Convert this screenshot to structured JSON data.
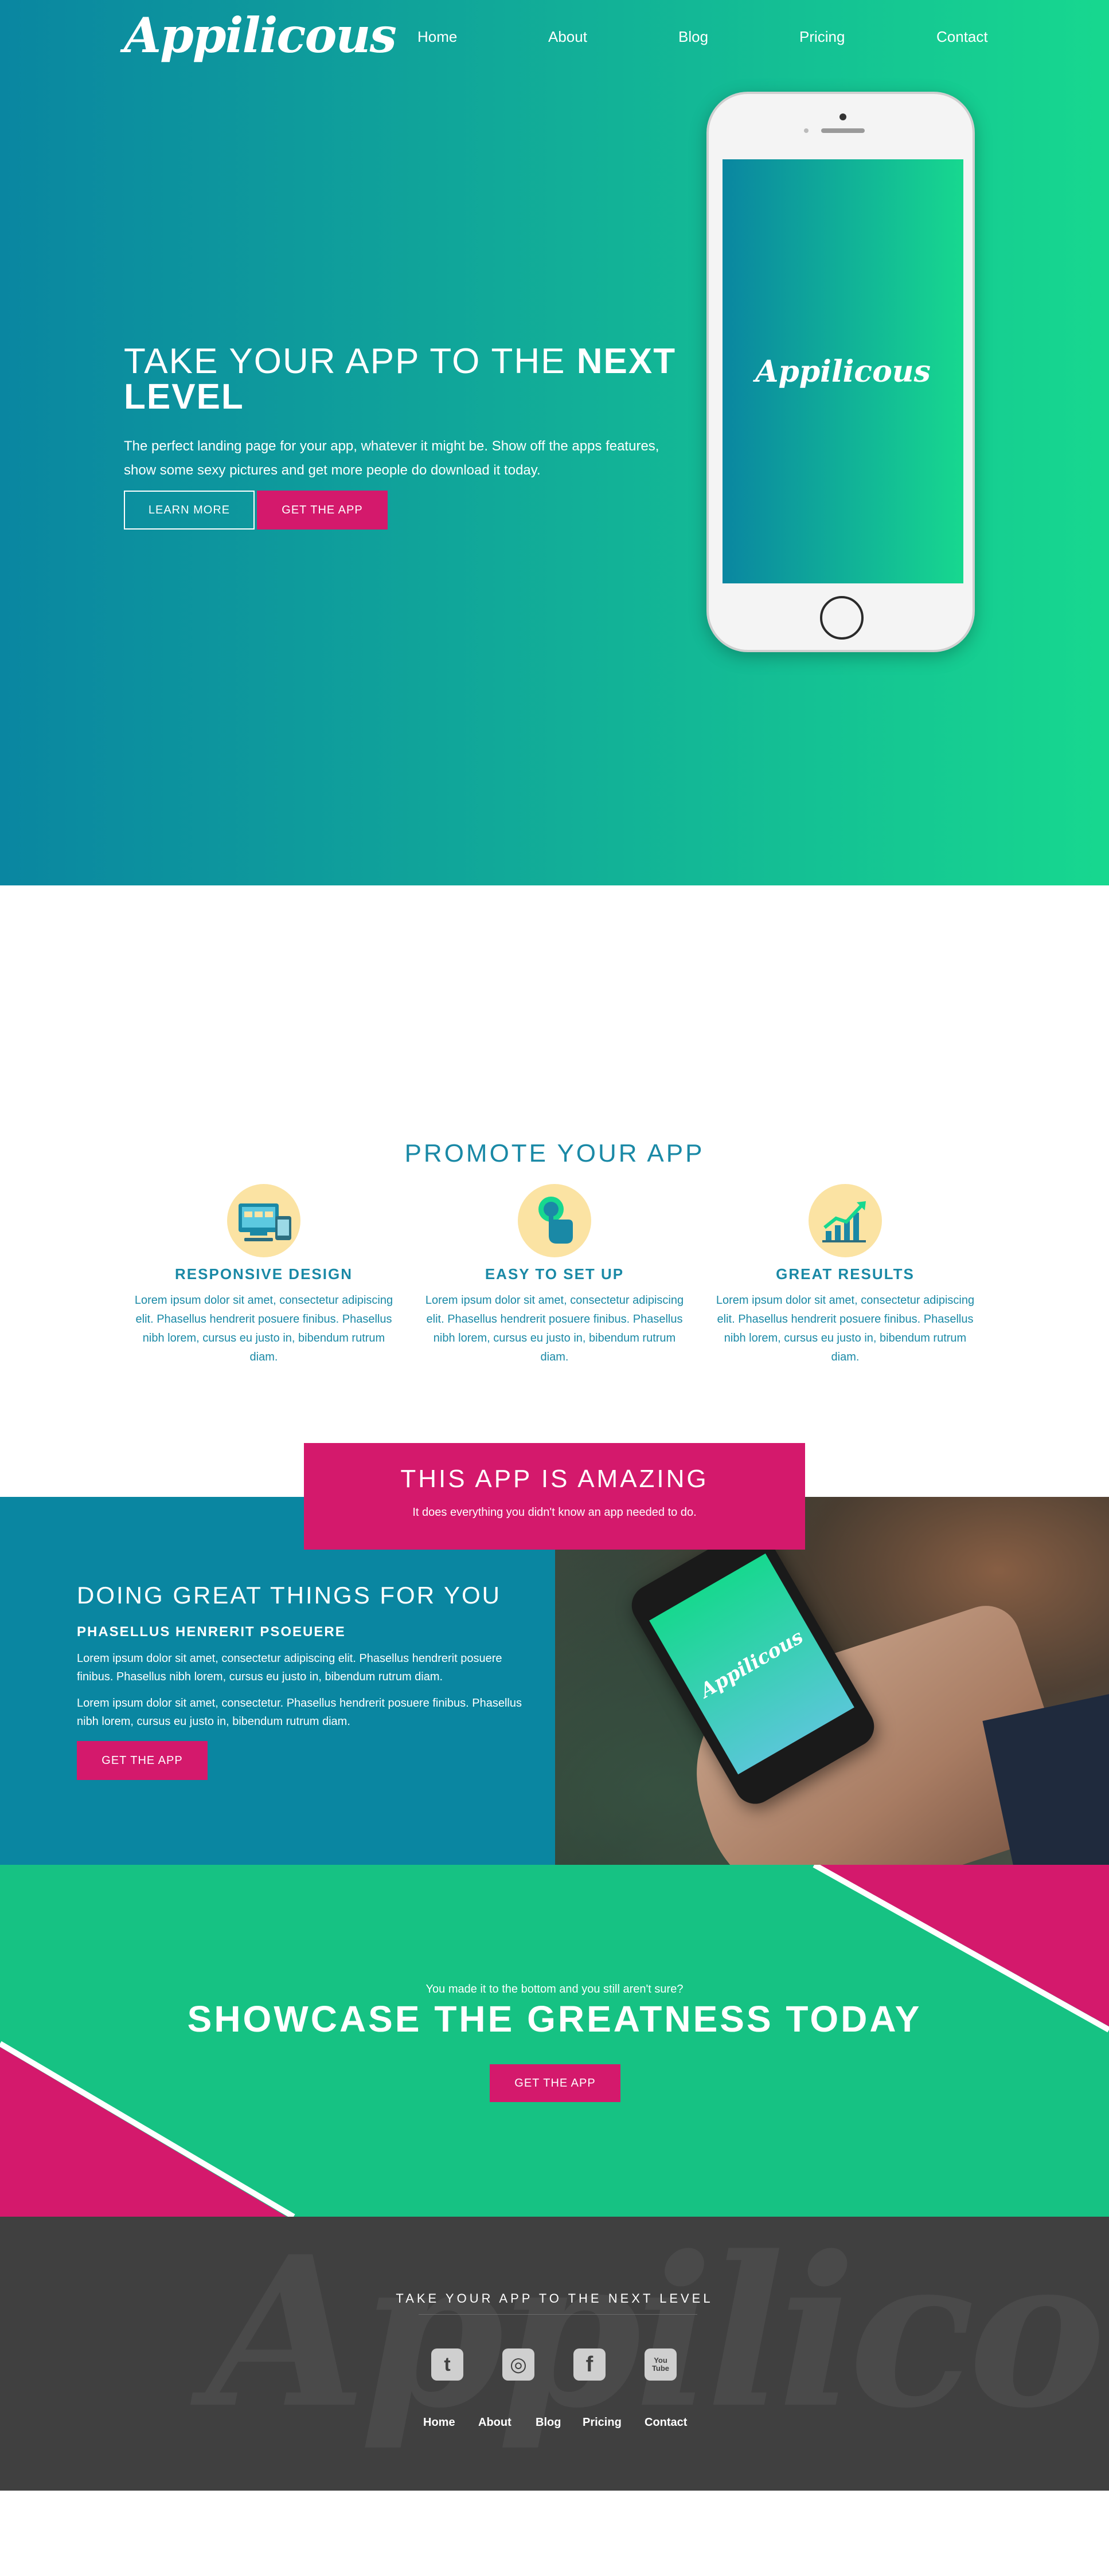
{
  "brand": {
    "logo": "Appilicous"
  },
  "nav": [
    "Home",
    "About",
    "Blog",
    "Pricing",
    "Contact"
  ],
  "hero": {
    "title_light": "TAKE YOUR APP TO THE ",
    "title_bold": "NEXT LEVEL",
    "subtitle": "The perfect landing page for your app, whatever it might be. Show off the apps features, show some sexy pictures and get more people do download it today.",
    "learn_more": "LEARN MORE",
    "get_app": "GET THE APP",
    "phone_logo": "Appilicous"
  },
  "promote": {
    "title": "PROMOTE YOUR APP",
    "features": [
      {
        "icon": "responsive-design-icon",
        "title": "RESPONSIVE DESIGN",
        "text": "Lorem ipsum dolor sit amet, consectetur adipiscing elit. Phasellus hendrerit posuere finibus. Phasellus nibh lorem, cursus eu justo in, bibendum rutrum diam."
      },
      {
        "icon": "tap-hand-icon",
        "title": "EASY TO SET UP",
        "text": "Lorem ipsum dolor sit amet, consectetur adipiscing elit. Phasellus hendrerit posuere finibus. Phasellus nibh lorem, cursus eu justo in, bibendum rutrum diam."
      },
      {
        "icon": "growth-chart-icon",
        "title": "GREAT RESULTS",
        "text": "Lorem ipsum dolor sit amet, consectetur adipiscing elit. Phasellus hendrerit posuere finibus. Phasellus nibh lorem, cursus eu justo in, bibendum rutrum diam."
      }
    ]
  },
  "amazing": {
    "title": "THIS APP IS AMAZING",
    "subtitle": "It does everything you didn't know an app needed to do."
  },
  "doing": {
    "title": "DOING GREAT THINGS FOR YOU",
    "subtitle": "PHASELLUS HENRERIT PSOEUERE",
    "p1": "Lorem ipsum dolor sit amet, consectetur adipiscing elit. Phasellus hendrerit posuere finibus. Phasellus nibh lorem, cursus eu justo in, bibendum rutrum diam.",
    "p2": "Lorem ipsum dolor sit amet, consectetur. Phasellus hendrerit posuere finibus. Phasellus nibh lorem, cursus eu justo in, bibendum rutrum diam.",
    "button": "GET THE APP",
    "photo_logo": "Appilicous"
  },
  "showcase": {
    "small": "You made it to the bottom and you still aren't sure?",
    "title": "SHOWCASE THE GREATNESS TODAY",
    "button": "GET THE APP"
  },
  "footer": {
    "watermark": "Appilicous",
    "tagline": "TAKE YOUR APP TO THE NEXT LEVEL",
    "social": [
      {
        "icon": "twitter-icon",
        "glyph": "t"
      },
      {
        "icon": "instagram-icon",
        "glyph": "◎"
      },
      {
        "icon": "facebook-icon",
        "glyph": "f"
      },
      {
        "icon": "youtube-icon",
        "glyph": "You Tube"
      }
    ],
    "nav": [
      "Home",
      "About",
      "Blog",
      "Pricing",
      "Contact"
    ]
  },
  "colors": {
    "teal": "#0a86a1",
    "green": "#17d88f",
    "pink": "#d4196c",
    "feature_text": "#1a89a6",
    "icon_bg": "#fbe3a3",
    "footer_bg": "#404040"
  }
}
